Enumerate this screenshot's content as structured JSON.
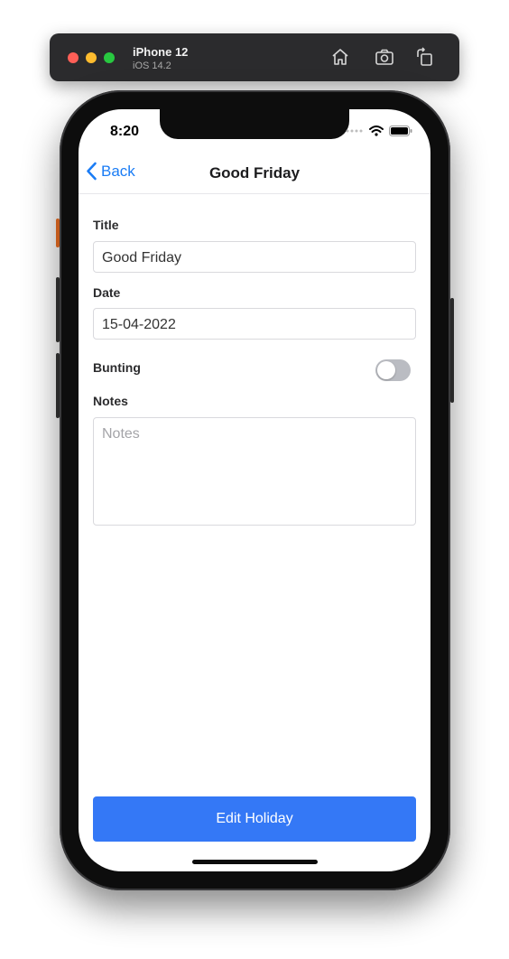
{
  "simulator": {
    "device_name": "iPhone 12",
    "os_version": "iOS 14.2",
    "toolbar_icons": [
      "home-icon",
      "screenshot-icon",
      "rotate-icon"
    ]
  },
  "status_bar": {
    "time": "8:20",
    "icons": [
      "cellular-icon",
      "wifi-icon",
      "battery-icon"
    ]
  },
  "nav": {
    "back_label": "Back",
    "title": "Good Friday"
  },
  "form": {
    "title_label": "Title",
    "title_value": "Good Friday",
    "date_label": "Date",
    "date_value": "15-04-2022",
    "bunting_label": "Bunting",
    "bunting_on": false,
    "notes_label": "Notes",
    "notes_placeholder": "Notes",
    "notes_value": ""
  },
  "actions": {
    "submit_label": "Edit Holiday"
  },
  "colors": {
    "accent": "#1a7cf5",
    "button": "#3478f6",
    "toggle_off": "#babcc2"
  }
}
